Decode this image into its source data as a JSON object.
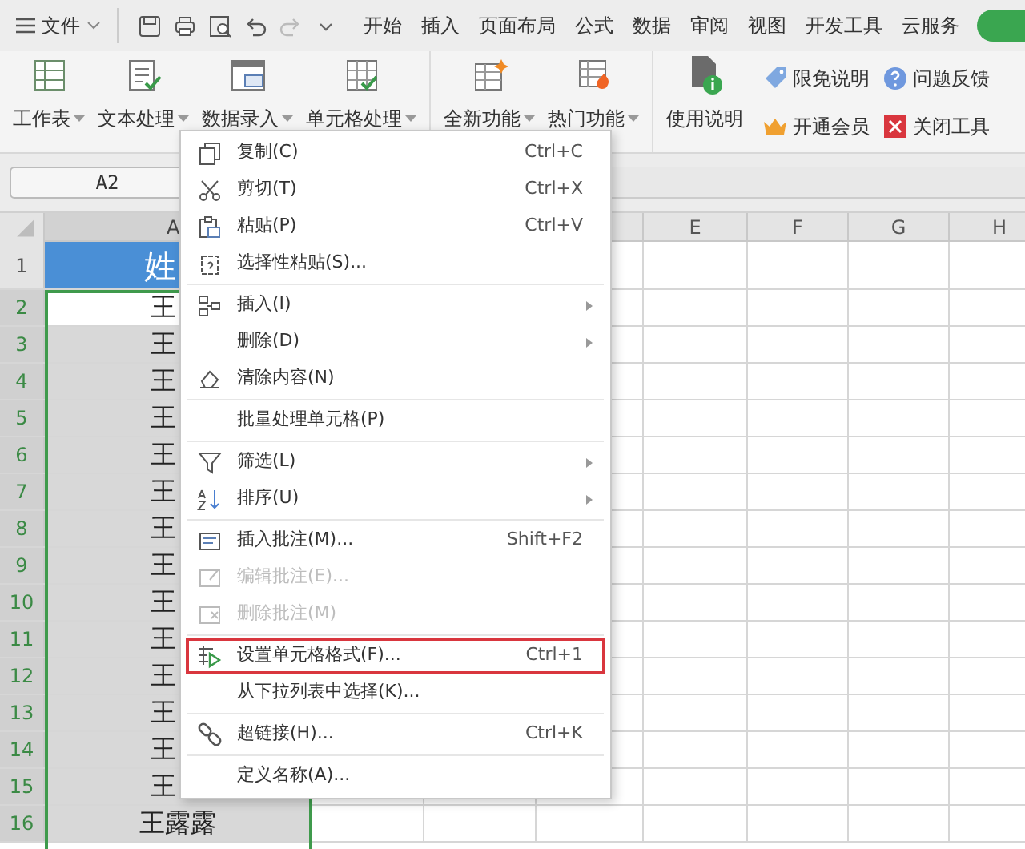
{
  "title_bar": {
    "file_menu": "文件",
    "tabs": [
      {
        "label": "开始",
        "selected": false
      },
      {
        "label": "插入",
        "selected": false
      },
      {
        "label": "页面布局",
        "selected": false
      },
      {
        "label": "公式",
        "selected": false
      },
      {
        "label": "数据",
        "selected": false
      },
      {
        "label": "审阅",
        "selected": false
      },
      {
        "label": "视图",
        "selected": false
      },
      {
        "label": "开发工具",
        "selected": false
      },
      {
        "label": "云服务",
        "selected": false
      }
    ]
  },
  "ribbon": {
    "groups": [
      {
        "buttons": [
          {
            "label": "工作表",
            "dropdown": true
          },
          {
            "label": "文本处理",
            "dropdown": true
          },
          {
            "label": "数据录入",
            "dropdown": true
          },
          {
            "label": "单元格处理",
            "dropdown": true
          }
        ]
      },
      {
        "buttons": [
          {
            "label": "全新功能",
            "dropdown": true
          },
          {
            "label": "热门功能",
            "dropdown": true
          }
        ]
      }
    ],
    "help": {
      "label": "使用说明"
    },
    "links": [
      {
        "label": "限免说明"
      },
      {
        "label": "问题反馈"
      },
      {
        "label": "开通会员"
      },
      {
        "label": "关闭工具"
      }
    ]
  },
  "name_box": {
    "value": "A2"
  },
  "columns": [
    {
      "label": "A",
      "selected": true
    },
    {
      "label": "E",
      "selected": false
    },
    {
      "label": "F",
      "selected": false
    },
    {
      "label": "G",
      "selected": false
    },
    {
      "label": "H",
      "selected": false
    }
  ],
  "rows": [
    {
      "number": "1",
      "cell": "姓",
      "selected": false,
      "active": false,
      "header": true
    },
    {
      "number": "2",
      "cell": "王",
      "selected": true,
      "active": true,
      "header": false
    },
    {
      "number": "3",
      "cell": "王",
      "selected": true,
      "active": false,
      "header": false
    },
    {
      "number": "4",
      "cell": "王",
      "selected": true,
      "active": false,
      "header": false
    },
    {
      "number": "5",
      "cell": "王",
      "selected": true,
      "active": false,
      "header": false
    },
    {
      "number": "6",
      "cell": "王",
      "selected": true,
      "active": false,
      "header": false
    },
    {
      "number": "7",
      "cell": "王",
      "selected": true,
      "active": false,
      "header": false
    },
    {
      "number": "8",
      "cell": "王",
      "selected": true,
      "active": false,
      "header": false
    },
    {
      "number": "9",
      "cell": "王",
      "selected": true,
      "active": false,
      "header": false
    },
    {
      "number": "10",
      "cell": "王",
      "selected": true,
      "active": false,
      "header": false
    },
    {
      "number": "11",
      "cell": "王",
      "selected": true,
      "active": false,
      "header": false
    },
    {
      "number": "12",
      "cell": "王",
      "selected": true,
      "active": false,
      "header": false
    },
    {
      "number": "13",
      "cell": "王",
      "selected": true,
      "active": false,
      "header": false
    },
    {
      "number": "14",
      "cell": "王",
      "selected": true,
      "active": false,
      "header": false
    },
    {
      "number": "15",
      "cell": "王",
      "selected": true,
      "active": false,
      "header": false
    },
    {
      "number": "16",
      "cell": "王露露",
      "selected": true,
      "active": false,
      "header": false
    }
  ],
  "context_menu": {
    "groups": [
      [
        {
          "label": "复制(C)",
          "shortcut": "Ctrl+C",
          "submenu": false,
          "disabled": false,
          "highlighted": false
        },
        {
          "label": "剪切(T)",
          "shortcut": "Ctrl+X",
          "submenu": false,
          "disabled": false,
          "highlighted": false
        },
        {
          "label": "粘贴(P)",
          "shortcut": "Ctrl+V",
          "submenu": false,
          "disabled": false,
          "highlighted": false
        },
        {
          "label": "选择性粘贴(S)...",
          "submenu": false,
          "disabled": false,
          "highlighted": false
        }
      ],
      [
        {
          "label": "插入(I)",
          "submenu": true,
          "disabled": false,
          "highlighted": false
        },
        {
          "label": "删除(D)",
          "submenu": true,
          "disabled": false,
          "highlighted": false
        },
        {
          "label": "清除内容(N)",
          "submenu": false,
          "disabled": false,
          "highlighted": false
        }
      ],
      [
        {
          "label": "批量处理单元格(P)",
          "submenu": false,
          "disabled": false,
          "highlighted": false
        }
      ],
      [
        {
          "label": "筛选(L)",
          "submenu": true,
          "disabled": false,
          "highlighted": false
        },
        {
          "label": "排序(U)",
          "submenu": true,
          "disabled": false,
          "highlighted": false
        }
      ],
      [
        {
          "label": "插入批注(M)...",
          "shortcut": "Shift+F2",
          "submenu": false,
          "disabled": false,
          "highlighted": false
        },
        {
          "label": "编辑批注(E)...",
          "submenu": false,
          "disabled": true,
          "highlighted": false
        },
        {
          "label": "删除批注(M)",
          "submenu": false,
          "disabled": true,
          "highlighted": false
        }
      ],
      [
        {
          "label": "设置单元格格式(F)...",
          "shortcut": "Ctrl+1",
          "submenu": false,
          "disabled": false,
          "highlighted": true
        },
        {
          "label": "从下拉列表中选择(K)...",
          "submenu": false,
          "disabled": false,
          "highlighted": false
        }
      ],
      [
        {
          "label": "超链接(H)...",
          "shortcut": "Ctrl+K",
          "submenu": false,
          "disabled": false,
          "highlighted": false
        }
      ],
      [
        {
          "label": "定义名称(A)...",
          "submenu": false,
          "disabled": false,
          "highlighted": false
        }
      ]
    ]
  }
}
